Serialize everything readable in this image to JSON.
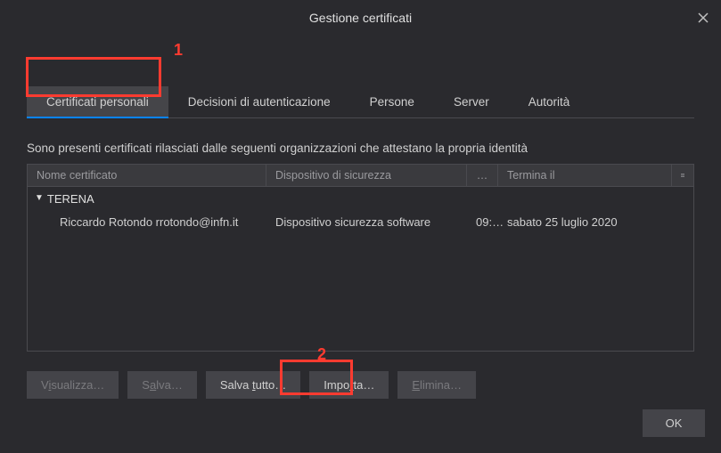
{
  "title": "Gestione certificati",
  "annotations": {
    "one": "1",
    "two": "2"
  },
  "tabs": {
    "personal": "Certificati personali",
    "authdec": "Decisioni di autenticazione",
    "people": "Persone",
    "servers": "Server",
    "authorities": "Autorità"
  },
  "description": "Sono presenti certificati rilasciati dalle seguenti organizzazioni che attestano la propria identità",
  "columns": {
    "name": "Nome certificato",
    "device": "Dispositivo di sicurezza",
    "dots": "…",
    "expires": "Termina il"
  },
  "group": "TERENA",
  "row": {
    "name": "Riccardo Rotondo rrotondo@infn.it",
    "device": "Dispositivo sicurezza software",
    "time": "09:…",
    "expires": "sabato 25 luglio 2020"
  },
  "buttons": {
    "view_pre": "V",
    "view_u": "i",
    "view_post": "sualizza…",
    "save_pre": "S",
    "save_u": "a",
    "save_post": "lva…",
    "saveall_pre": "Salva ",
    "saveall_u": "t",
    "saveall_post": "utto…",
    "import_pre": "Impo",
    "import_u": "r",
    "import_post": "ta…",
    "delete_pre": "",
    "delete_u": "E",
    "delete_post": "limina…",
    "ok": "OK"
  }
}
